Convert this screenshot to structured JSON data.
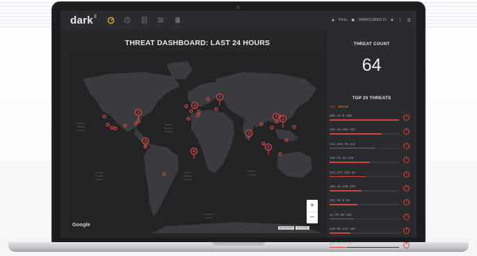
{
  "app": {
    "logo_text": "dark",
    "logo_superscript": "3",
    "user_label": "Pictu",
    "org_label": "DARKCUBED CI",
    "nav_icons": [
      "radar-icon",
      "clock-icon",
      "document-icon",
      "filter-icon",
      "book-icon"
    ]
  },
  "dashboard": {
    "title": "THREAT DASHBOARD: LAST 24 HOURS"
  },
  "map": {
    "google_label": "Google",
    "zoom_in": "+",
    "zoom_out": "−",
    "attribution": [
      "Map data ©2017",
      "Terms of Use"
    ],
    "ocean_labels": {
      "north_pacific": "North\nPacific\nOcean",
      "north_atlantic": "North\nAtlantic\nOcean",
      "south_pacific": "South\nPacific\nOcean",
      "south_atlantic": "South\nAtlantic\nOcean",
      "indian": "Indian\nOcean",
      "southern": "Southern\nOcean"
    },
    "cluster_counts": [
      "2",
      "4",
      "2",
      "3",
      "3",
      "2",
      "3",
      "2",
      "4"
    ]
  },
  "threat_count": {
    "title": "THREAT COUNT",
    "value": "64"
  },
  "top_threats": {
    "title": "TOP 20 THREATS",
    "legend_high": "HIGH",
    "legend_medium": "MEDIUM",
    "rows": [
      {
        "ip": "106.12.8.189",
        "severity": 1.0
      },
      {
        "ip": "162.16.186.132",
        "severity": 0.75
      },
      {
        "ip": "111.161.76.112",
        "severity": 0.65
      },
      {
        "ip": "125.74.12.148",
        "severity": 0.58
      },
      {
        "ip": "112.217.225.34",
        "severity": 0.52
      },
      {
        "ip": "129.54.249.223",
        "severity": 0.46
      },
      {
        "ip": "112.65.9.28",
        "severity": 0.4
      },
      {
        "ip": "11.75.96.195",
        "severity": 0.35
      },
      {
        "ip": "119.60.113.126",
        "severity": 0.3
      },
      {
        "ip": "141.98.87.37",
        "severity": 0.25
      }
    ]
  },
  "colors": {
    "accent": "#e3a52b",
    "threat_red": "#d8453a",
    "background": "#252628"
  }
}
